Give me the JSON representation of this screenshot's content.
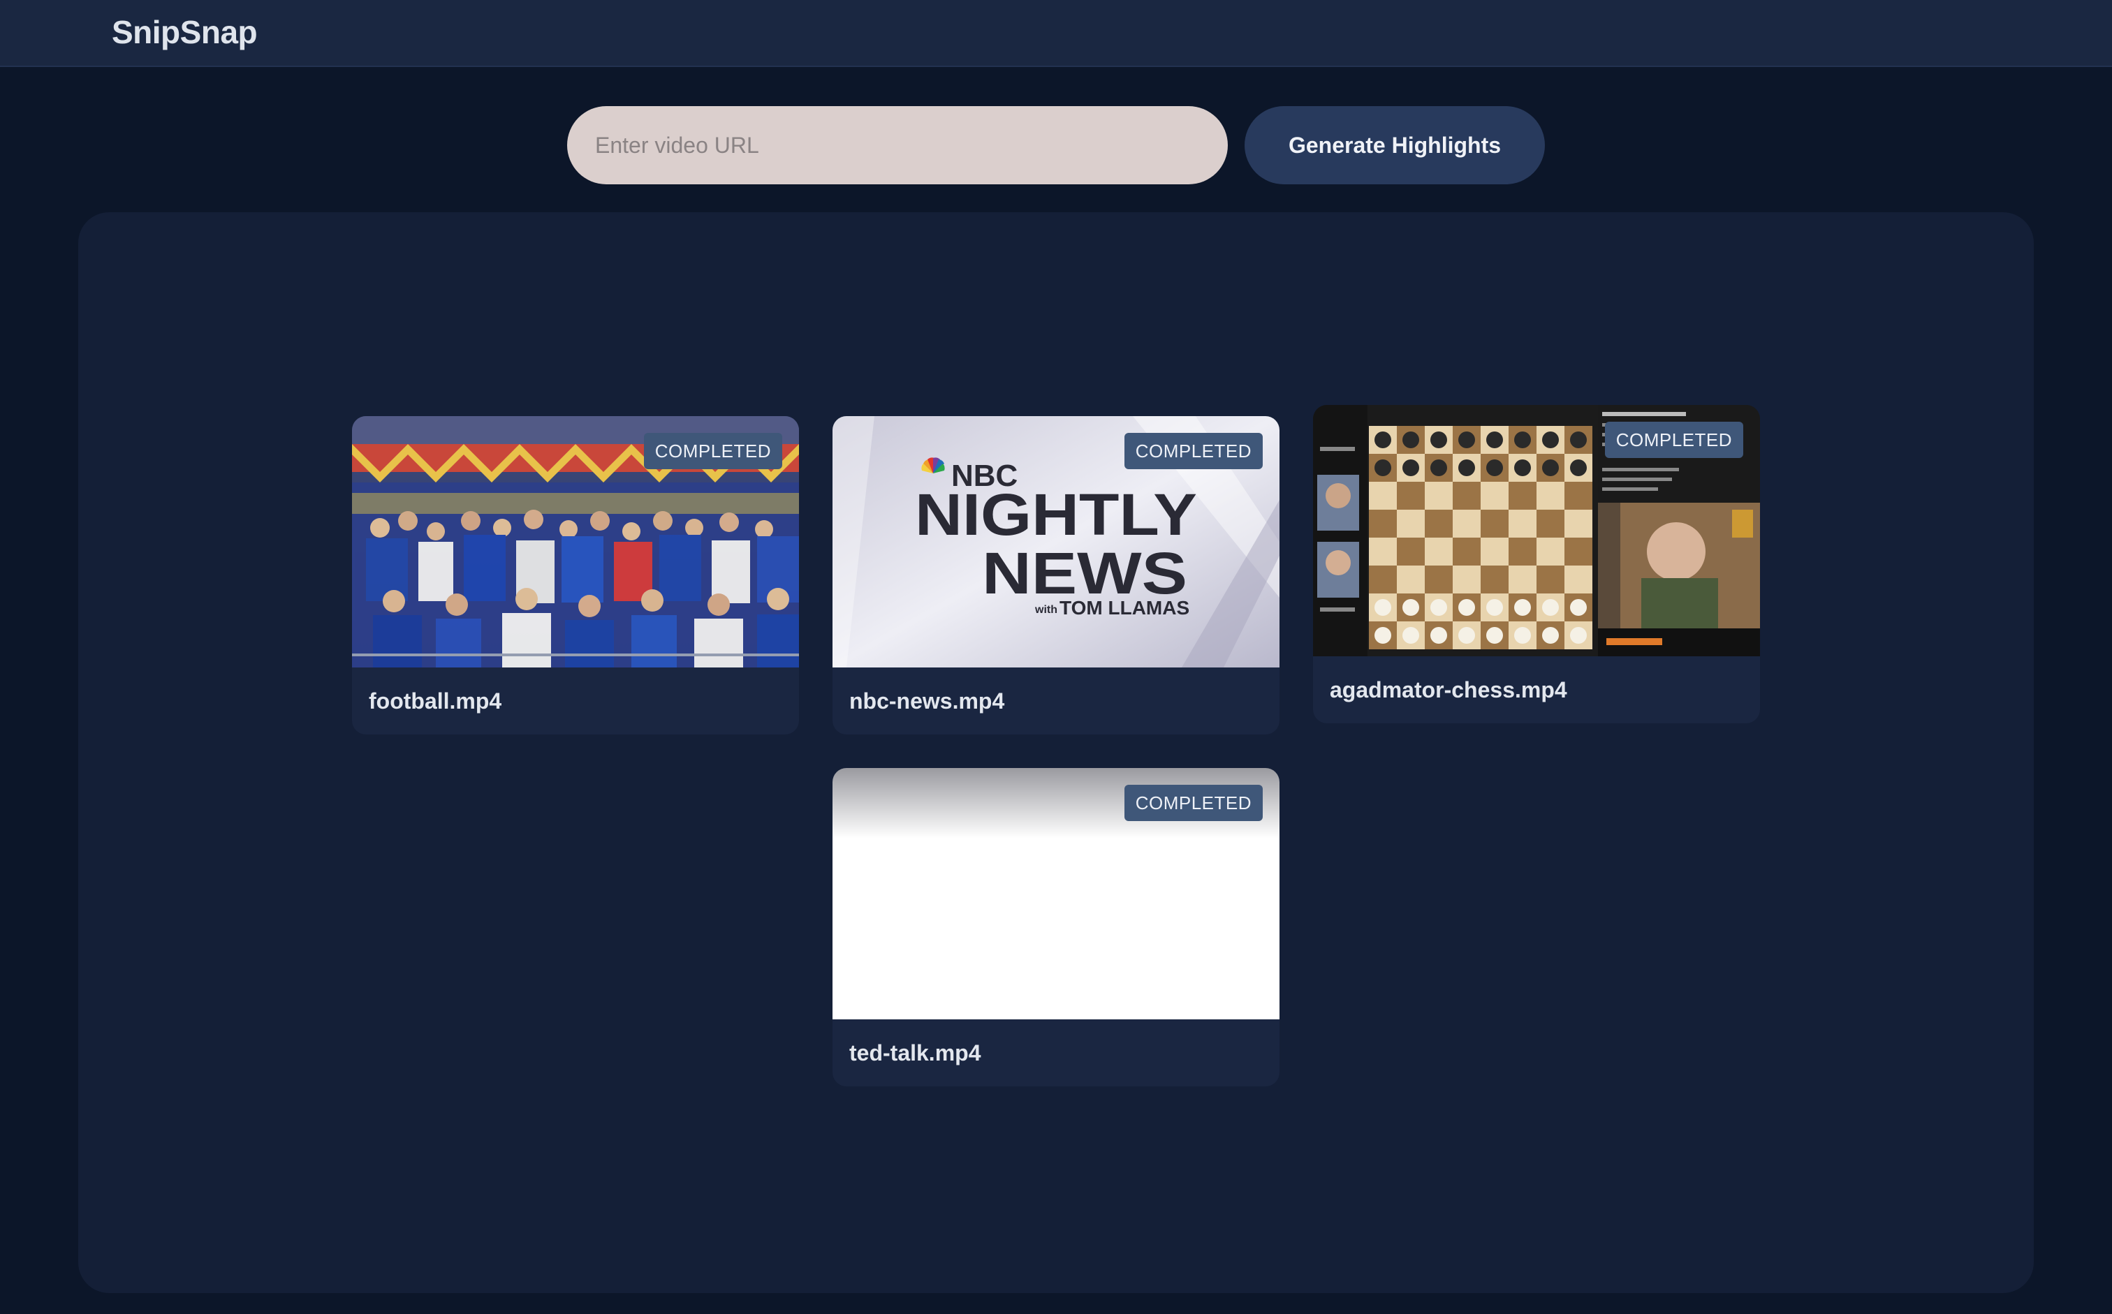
{
  "app": {
    "title": "SnipSnap"
  },
  "search": {
    "placeholder": "Enter video URL",
    "value": "",
    "button_label": "Generate Highlights"
  },
  "videos": [
    {
      "filename": "football.mp4",
      "status": "COMPLETED",
      "thumbnail": "stadium-crowd"
    },
    {
      "filename": "nbc-news.mp4",
      "status": "COMPLETED",
      "thumbnail": "nbc-nightly-news-logo",
      "thumbnail_text": {
        "brand": "NBC",
        "line1": "NIGHTLY",
        "line2": "NEWS",
        "with": "with",
        "anchor": "TOM LLAMAS"
      }
    },
    {
      "filename": "agadmator-chess.mp4",
      "status": "COMPLETED",
      "thumbnail": "chess-board-stream"
    },
    {
      "filename": "ted-talk.mp4",
      "status": "COMPLETED",
      "thumbnail": "blank-white"
    }
  ],
  "colors": {
    "background": "#0c1629",
    "topbar": "#1a2741",
    "panel": "#141f37",
    "card": "#1a2641",
    "badge": "#3f5779",
    "input": "#dbcfcd",
    "button": "#283a5d"
  }
}
